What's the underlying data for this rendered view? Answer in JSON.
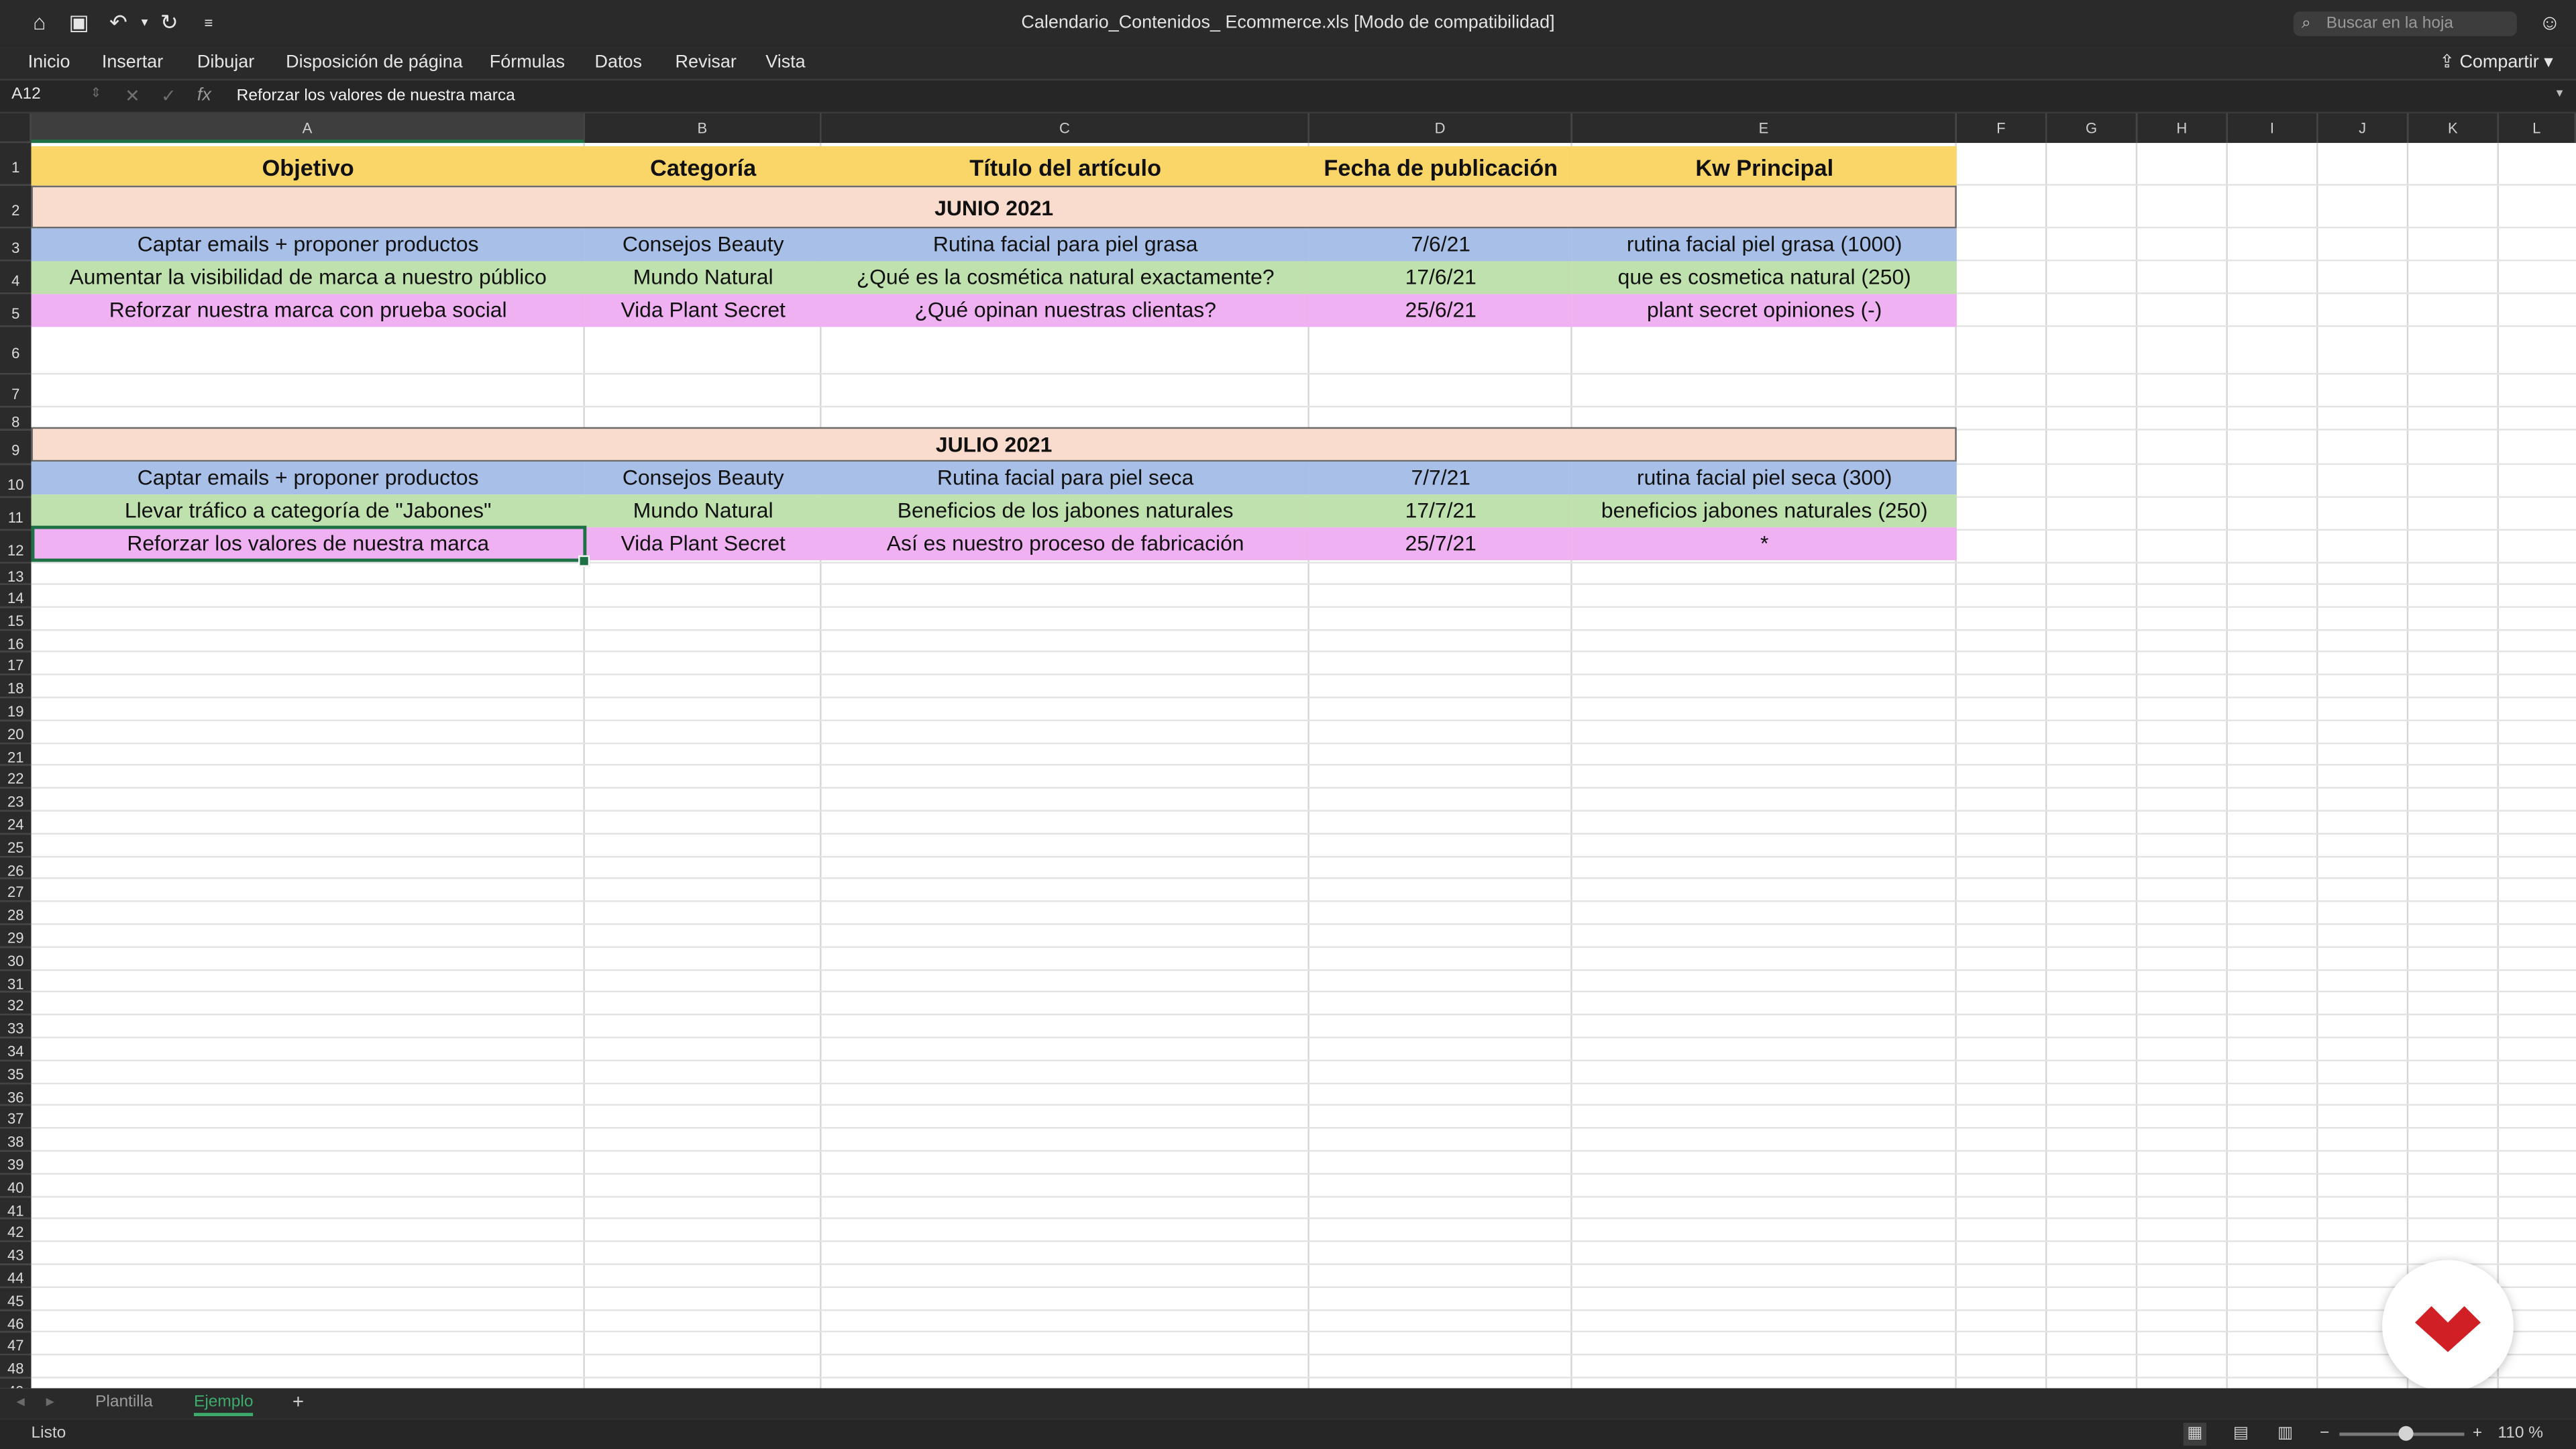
{
  "window": {
    "title": "Calendario_Contenidos_ Ecommerce.xls  [Modo de compatibilidad]",
    "search_placeholder": "Buscar en la hoja"
  },
  "menu": {
    "items": [
      "Inicio",
      "Insertar",
      "Dibujar",
      "Disposición de página",
      "Fórmulas",
      "Datos",
      "Revisar",
      "Vista"
    ],
    "share_label": "Compartir"
  },
  "formula_bar": {
    "cell_ref": "A12",
    "fx": "fx",
    "content": "Reforzar los valores de nuestra marca"
  },
  "columns": [
    "A",
    "B",
    "C",
    "D",
    "E",
    "F",
    "G",
    "H",
    "I",
    "J",
    "K",
    "L"
  ],
  "rows": [
    "1",
    "2",
    "3",
    "4",
    "5",
    "6",
    "7",
    "8",
    "9",
    "10",
    "11",
    "12",
    "13",
    "14",
    "15",
    "16",
    "17",
    "18",
    "19",
    "20",
    "21",
    "22",
    "23",
    "24",
    "25",
    "26",
    "27",
    "28",
    "29",
    "30",
    "31",
    "32",
    "33",
    "34",
    "35",
    "36",
    "37",
    "38",
    "39",
    "40",
    "41",
    "42",
    "43",
    "44",
    "45",
    "46",
    "47",
    "48",
    "49"
  ],
  "headers": [
    "Objetivo",
    "Categoría",
    "Título del artículo",
    "Fecha de publicación",
    "Kw Principal"
  ],
  "june": {
    "title": "JUNIO 2021",
    "rows": [
      [
        "Captar emails + proponer productos",
        "Consejos Beauty",
        "Rutina facial para piel grasa",
        "7/6/21",
        "rutina facial piel grasa (1000)"
      ],
      [
        "Aumentar la visibilidad de marca a nuestro público",
        "Mundo Natural",
        "¿Qué es la cosmética natural exactamente?",
        "17/6/21",
        "que es cosmetica natural (250)"
      ],
      [
        "Reforzar nuestra marca con prueba social",
        "Vida Plant Secret",
        "¿Qué opinan nuestras clientas?",
        "25/6/21",
        "plant secret opiniones (-)"
      ]
    ]
  },
  "july": {
    "title": "JULIO 2021",
    "rows": [
      [
        "Captar emails + proponer productos",
        "Consejos Beauty",
        "Rutina facial para piel seca",
        "7/7/21",
        "rutina facial piel seca (300)"
      ],
      [
        "Llevar tráfico a categoría de \"Jabones\"",
        "Mundo Natural",
        "Beneficios de los jabones naturales",
        "17/7/21",
        "beneficios jabones naturales (250)"
      ],
      [
        "Reforzar los valores de nuestra marca",
        "Vida Plant Secret",
        "Así es nuestro proceso de fabricación",
        "25/7/21",
        "*"
      ]
    ]
  },
  "sheets": {
    "tabs": [
      "Plantilla",
      "Ejemplo"
    ],
    "active": "Ejemplo",
    "add": "+"
  },
  "status": {
    "text": "Listo",
    "zoom": "110 %"
  },
  "colors": {
    "header": "#fad567",
    "month": "#f9dccd",
    "blue": "#a8bfe7",
    "green": "#bfe1ad",
    "pink": "#efb1f2",
    "accent": "#1e7145"
  },
  "icons": [
    "home-icon",
    "save-icon",
    "undo-icon",
    "redo-icon",
    "customize-icon",
    "search-icon",
    "person-icon",
    "share-icon",
    "grid-view-icon",
    "page-layout-icon",
    "page-break-icon"
  ]
}
